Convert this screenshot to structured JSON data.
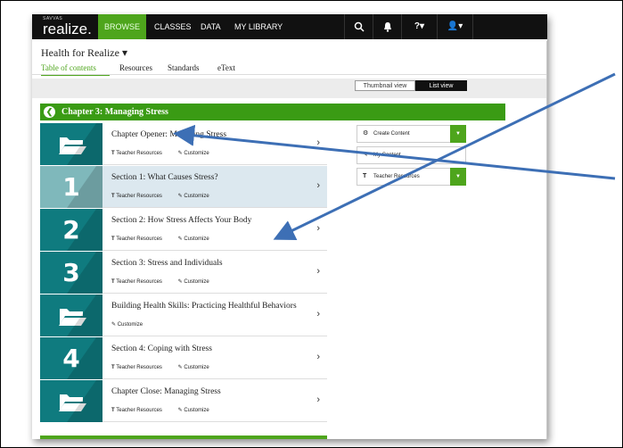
{
  "brand": {
    "publisher": "SAVVAS",
    "name": "realize."
  },
  "nav": [
    {
      "label": "BROWSE",
      "active": true
    },
    {
      "label": "CLASSES",
      "active": false
    },
    {
      "label": "DATA",
      "active": false
    },
    {
      "label": "MY LIBRARY",
      "active": false
    }
  ],
  "toolbar": {
    "help_label": "?▾",
    "user_label": "👤▾"
  },
  "course": {
    "title": "Health for Realize ▾"
  },
  "tabs": [
    {
      "label": "Table of contents",
      "active": true
    },
    {
      "label": "Resources",
      "active": false
    },
    {
      "label": "Standards",
      "active": false
    },
    {
      "label": "eText",
      "active": false
    }
  ],
  "view": {
    "thumbnail": "Thumbnail view",
    "list": "List view"
  },
  "chapter": {
    "title": "Chapter 3: Managing Stress"
  },
  "rows": [
    {
      "tile": "folder",
      "title": "Chapter Opener: Managing Stress",
      "links": [
        "Teacher Resources",
        "Customize"
      ]
    },
    {
      "tile": "1",
      "title": "Section 1: What Causes Stress?",
      "links": [
        "Teacher Resources",
        "Customize"
      ]
    },
    {
      "tile": "2",
      "title": "Section 2: How Stress Affects Your Body",
      "links": [
        "Teacher Resources",
        "Customize"
      ]
    },
    {
      "tile": "3",
      "title": "Section 3: Stress and Individuals",
      "links": [
        "Teacher Resources",
        "Customize"
      ]
    },
    {
      "tile": "folder",
      "title": "Building Health Skills: Practicing Healthful Behaviors",
      "links": [
        "Customize"
      ]
    },
    {
      "tile": "4",
      "title": "Section 4: Coping with Stress",
      "links": [
        "Teacher Resources",
        "Customize"
      ]
    },
    {
      "tile": "folder",
      "title": "Chapter Close: Managing Stress",
      "links": [
        "Teacher Resources",
        "Customize"
      ]
    }
  ],
  "panel": {
    "create": "Create Content",
    "my": "My Content",
    "teacher": "Teacher Resources"
  },
  "colors": {
    "accent": "#4ea51c",
    "tile": "#0f7b7f",
    "arrow": "#3d6fb5"
  }
}
